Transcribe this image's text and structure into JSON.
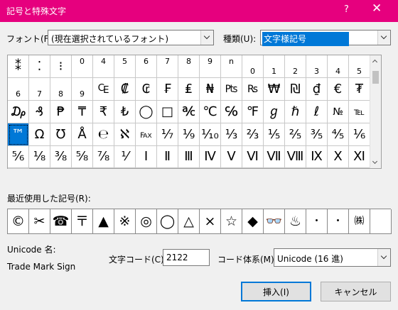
{
  "window": {
    "title": "記号と特殊文字",
    "help_label": "?",
    "close_label": "✕"
  },
  "font": {
    "label": "フォント(F):",
    "value": "(現在選択されているフォント)"
  },
  "subset": {
    "label": "種類(U):",
    "value": "文字様記号"
  },
  "symbols": [
    "⁑",
    "⁚",
    "⁝",
    "0",
    "4",
    "5",
    "6",
    "7",
    "8",
    "9",
    "n",
    "0",
    "1",
    "2",
    "3",
    "4",
    "5",
    "6",
    "7",
    "8",
    "9",
    "₠",
    "₡",
    "₢",
    "₣",
    "₤",
    "₦",
    "₧",
    "₨",
    "₩",
    "₪",
    "₫",
    "€",
    "₮",
    "₯",
    "₰",
    "₱",
    "₸",
    "₹",
    "₺",
    "◯",
    "□",
    "℀",
    "℃",
    "℅",
    "℉",
    "ℊ",
    "ℏ",
    "ℓ",
    "№",
    "℡",
    "™",
    "Ω",
    "℧",
    "Å",
    "℮",
    "ℵ",
    "℻",
    "⅐",
    "⅑",
    "⅒",
    "⅓",
    "⅔",
    "⅕",
    "⅖",
    "⅗",
    "⅘",
    "⅙",
    "⅚",
    "⅛",
    "⅜",
    "⅝",
    "⅞",
    "⅟",
    "Ⅰ",
    "Ⅱ",
    "Ⅲ",
    "Ⅳ",
    "Ⅴ",
    "Ⅵ",
    "Ⅶ",
    "Ⅷ",
    "Ⅸ",
    "Ⅹ",
    "Ⅺ",
    "Ⅻ"
  ],
  "selected_symbol": "™",
  "recent": {
    "label": "最近使用した記号(R):",
    "items": [
      "©",
      "✂",
      "☎",
      "〒",
      "▲",
      "※",
      "◎",
      "◯",
      "△",
      "×",
      "☆",
      "◆",
      "👓",
      "♨",
      "・",
      "・",
      "㈱",
      ""
    ]
  },
  "unicode_name": {
    "label": "Unicode 名:",
    "value": "Trade Mark Sign"
  },
  "char_code": {
    "label": "文字コード(C):",
    "value": "2122"
  },
  "from": {
    "label": "コード体系(M):",
    "value": "Unicode (16 進)"
  },
  "buttons": {
    "insert": "挿入(I)",
    "cancel": "キャンセル"
  }
}
